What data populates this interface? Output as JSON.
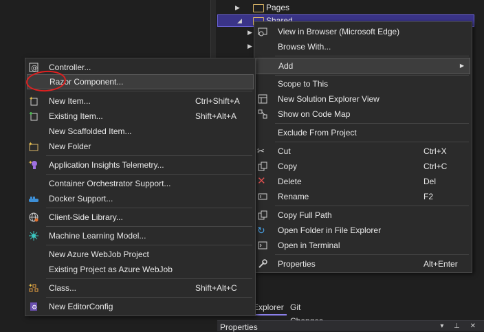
{
  "tree": {
    "items": [
      {
        "label": "Pages"
      },
      {
        "label": "Shared"
      }
    ]
  },
  "tabs": {
    "explorer": "Explorer",
    "git": "Git Changes"
  },
  "properties": {
    "title": "Properties",
    "icons": "▾ ⊥ ✕"
  },
  "main_menu": {
    "view_browser": "View in Browser (Microsoft Edge)",
    "browse_with": "Browse With...",
    "add": "Add",
    "scope": "Scope to This",
    "new_view": "New Solution Explorer View",
    "code_map": "Show on Code Map",
    "exclude": "Exclude From Project",
    "cut": "Cut",
    "cut_sc": "Ctrl+X",
    "copy": "Copy",
    "copy_sc": "Ctrl+C",
    "delete": "Delete",
    "delete_sc": "Del",
    "rename": "Rename",
    "rename_sc": "F2",
    "copy_path": "Copy Full Path",
    "open_folder": "Open Folder in File Explorer",
    "open_terminal": "Open in Terminal",
    "properties": "Properties",
    "properties_sc": "Alt+Enter"
  },
  "add_menu": {
    "controller": "Controller...",
    "razor": "Razor Component...",
    "new_item": "New Item...",
    "new_item_sc": "Ctrl+Shift+A",
    "existing_item": "Existing Item...",
    "existing_item_sc": "Shift+Alt+A",
    "scaffolded": "New Scaffolded Item...",
    "new_folder": "New Folder",
    "insights": "Application Insights Telemetry...",
    "orchestrator": "Container Orchestrator Support...",
    "docker": "Docker Support...",
    "client_lib": "Client-Side Library...",
    "ml_model": "Machine Learning Model...",
    "azure_webjob": "New Azure WebJob Project",
    "existing_webjob": "Existing Project as Azure WebJob",
    "class": "Class...",
    "class_sc": "Shift+Alt+C",
    "editorconfig": "New EditorConfig"
  }
}
